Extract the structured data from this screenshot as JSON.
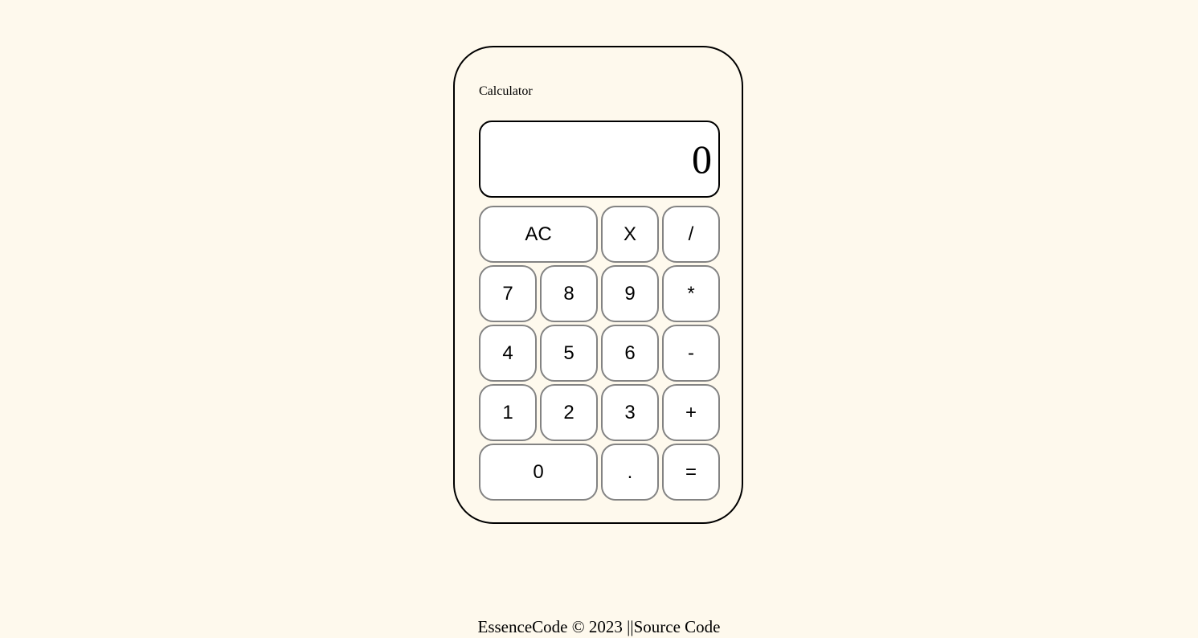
{
  "calculator": {
    "title": "Calculator",
    "display_value": "0",
    "buttons": {
      "ac": "AC",
      "del": "X",
      "divide": "/",
      "seven": "7",
      "eight": "8",
      "nine": "9",
      "multiply": "*",
      "four": "4",
      "five": "5",
      "six": "6",
      "minus": "-",
      "one": "1",
      "two": "2",
      "three": "3",
      "plus": "+",
      "zero": "0",
      "dot": ".",
      "equals": "="
    }
  },
  "footer": {
    "credit": "EssenceCode © 2023 ||",
    "source_link": "Source Code"
  },
  "colors": {
    "page_background": "#fef9ed",
    "button_border": "#838383"
  }
}
